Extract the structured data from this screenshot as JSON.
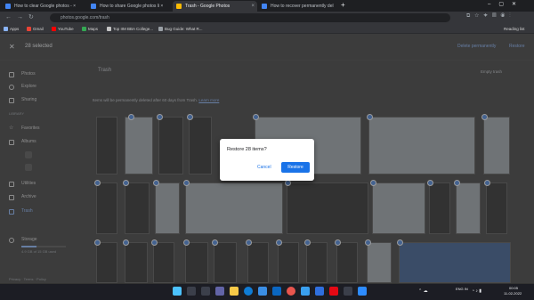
{
  "browser": {
    "tabs": [
      {
        "label": "How to clear Google photos - ×",
        "active": false
      },
      {
        "label": "How to share Google photos li ×",
        "active": false
      },
      {
        "label": "Trash - Google Photos",
        "active": true
      },
      {
        "label": "How to recover permanently del",
        "active": false
      }
    ],
    "url": "photos.google.com/trash",
    "bookmarks": [
      "Apps",
      "Gmail",
      "YouTube",
      "Maps",
      "Top IIM BBA College...",
      "Bug Guide: What R..."
    ],
    "reading_list": "Reading list"
  },
  "header": {
    "selected": "28 selected",
    "delete_permanently": "Delete permanently",
    "restore": "Restore"
  },
  "sidebar": {
    "items": [
      "Photos",
      "Explore",
      "Sharing"
    ],
    "library_label": "LIBRARY",
    "library_items": [
      "Favorites",
      "Albums",
      "Utilities",
      "Archive",
      "Trash"
    ],
    "storage_label": "Storage",
    "storage_text": "4.9 GB of 15 GB used",
    "footer": "Privacy · Terms · Policy"
  },
  "main": {
    "title": "Trash",
    "info": "Items will be permanently deleted after 60 days from Trash.",
    "learn_more": "Learn more",
    "empty_trash": "Empty trash"
  },
  "dialog": {
    "title": "Restore 28 items?",
    "cancel": "Cancel",
    "restore": "Restore"
  },
  "taskbar": {
    "lang": "ENG IN",
    "time": "00:05",
    "date": "11-02-2022"
  },
  "colors": {
    "accent": "#4a82d6",
    "restore_button": "#1a73e8"
  }
}
